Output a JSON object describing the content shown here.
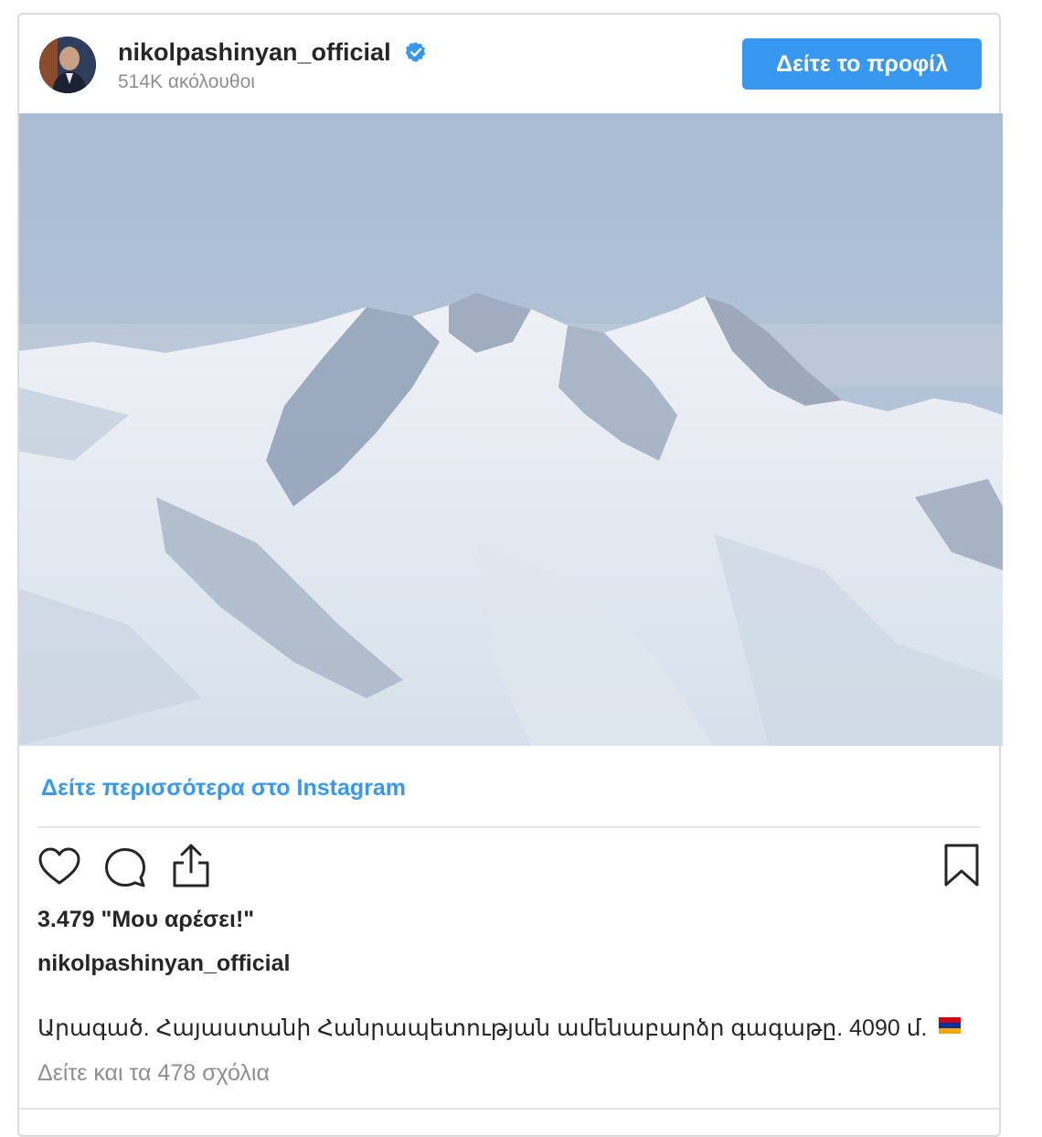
{
  "header": {
    "username": "nikolpashinyan_official",
    "followers": "514K ακόλουθοι",
    "profile_button": "Δείτε το προφίλ",
    "verified_icon": "verified-badge-icon",
    "verified_color": "#3897f0"
  },
  "post": {
    "more_link": "Δείτε περισσότερα στο Instagram",
    "likes": "3.479 \"Μου αρέσει!\"",
    "caption_username": "nikolpashinyan_official",
    "caption": "Արագած. Հայաստանի Հանրապետության ամենաբարձր գագաթը. 4090 մ.",
    "comments_link": "Δείτε και τα 478 σχόλια",
    "icons": [
      "heart-icon",
      "comment-icon",
      "share-icon",
      "bookmark-icon"
    ]
  },
  "colors": {
    "accent": "#3897f0",
    "muted": "#8e8e8e",
    "text": "#262626",
    "border": "#dbdbdb"
  }
}
